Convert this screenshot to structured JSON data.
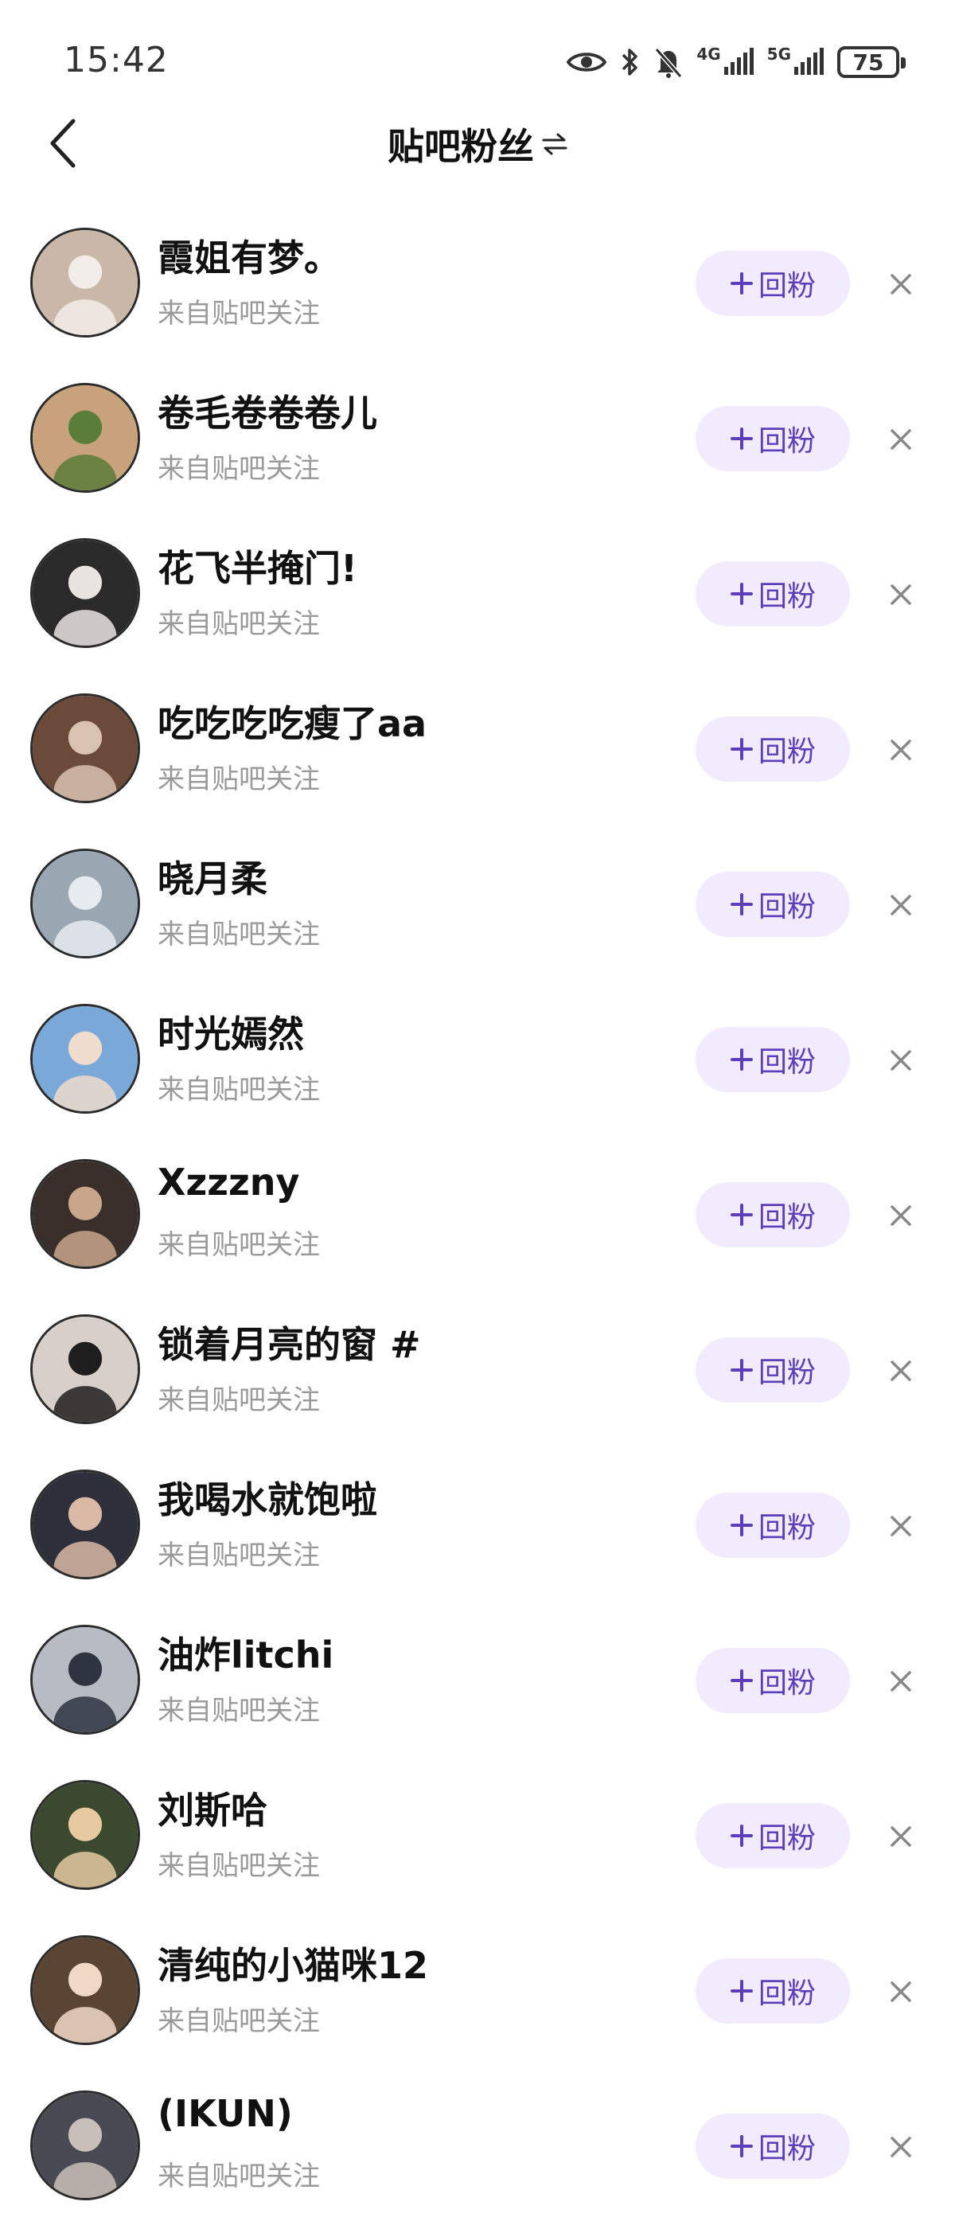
{
  "status_bar": {
    "time": "15:42",
    "network_1": "4G",
    "network_2": "5G",
    "battery": "75",
    "icons": [
      "eye-icon",
      "bluetooth-icon",
      "bell-muted-icon",
      "signal-4g-icon",
      "signal-5g-icon",
      "battery-icon"
    ]
  },
  "header": {
    "title": "贴吧粉丝",
    "switch_icon": "swap-icon"
  },
  "follow_back_label": "回粉",
  "fans": [
    {
      "name": "霞姐有梦。",
      "source": "来自贴吧关注",
      "avatar_color": "#c9b8a8",
      "avatar_accent": "#f2ede8"
    },
    {
      "name": "卷毛卷卷卷儿",
      "source": "来自贴吧关注",
      "avatar_color": "#c8a27a",
      "avatar_accent": "#5a7d3a"
    },
    {
      "name": "花飞半掩门!",
      "source": "来自贴吧关注",
      "avatar_color": "#2a2a2a",
      "avatar_accent": "#e8e4e0"
    },
    {
      "name": "吃吃吃吃瘦了aa",
      "source": "来自贴吧关注",
      "avatar_color": "#6b4a3a",
      "avatar_accent": "#d9c2b0"
    },
    {
      "name": "晓月柔",
      "source": "来自贴吧关注",
      "avatar_color": "#9aa7b3",
      "avatar_accent": "#e6ebef"
    },
    {
      "name": "时光嫣然",
      "source": "来自贴吧关注",
      "avatar_color": "#7aa8d8",
      "avatar_accent": "#f0dccc"
    },
    {
      "name": "Xzzzny",
      "source": "来自贴吧关注",
      "avatar_color": "#3a2e2a",
      "avatar_accent": "#c9a58a"
    },
    {
      "name": "锁着月亮的窗 #",
      "source": "来自贴吧关注",
      "avatar_color": "#d8cfc8",
      "avatar_accent": "#1e1e1e"
    },
    {
      "name": "我喝水就饱啦",
      "source": "来自贴吧关注",
      "avatar_color": "#2d2f3a",
      "avatar_accent": "#d9b8a6"
    },
    {
      "name": "油炸litchi",
      "source": "来自贴吧关注",
      "avatar_color": "#b7bcc4",
      "avatar_accent": "#2e3440"
    },
    {
      "name": "刘斯哈",
      "source": "来自贴吧关注",
      "avatar_color": "#3b4a2e",
      "avatar_accent": "#e6c9a0"
    },
    {
      "name": "清纯的小猫咪12",
      "source": "来自贴吧关注",
      "avatar_color": "#5a4535",
      "avatar_accent": "#f0d8c4"
    },
    {
      "name": "(IKUN)",
      "source": "来自贴吧关注",
      "avatar_color": "#4a4a55",
      "avatar_accent": "#c8c0b8"
    }
  ],
  "colors": {
    "accent": "#5c3fb8",
    "button_bg": "#f1ebfd",
    "secondary_text": "#9a9a9a"
  }
}
